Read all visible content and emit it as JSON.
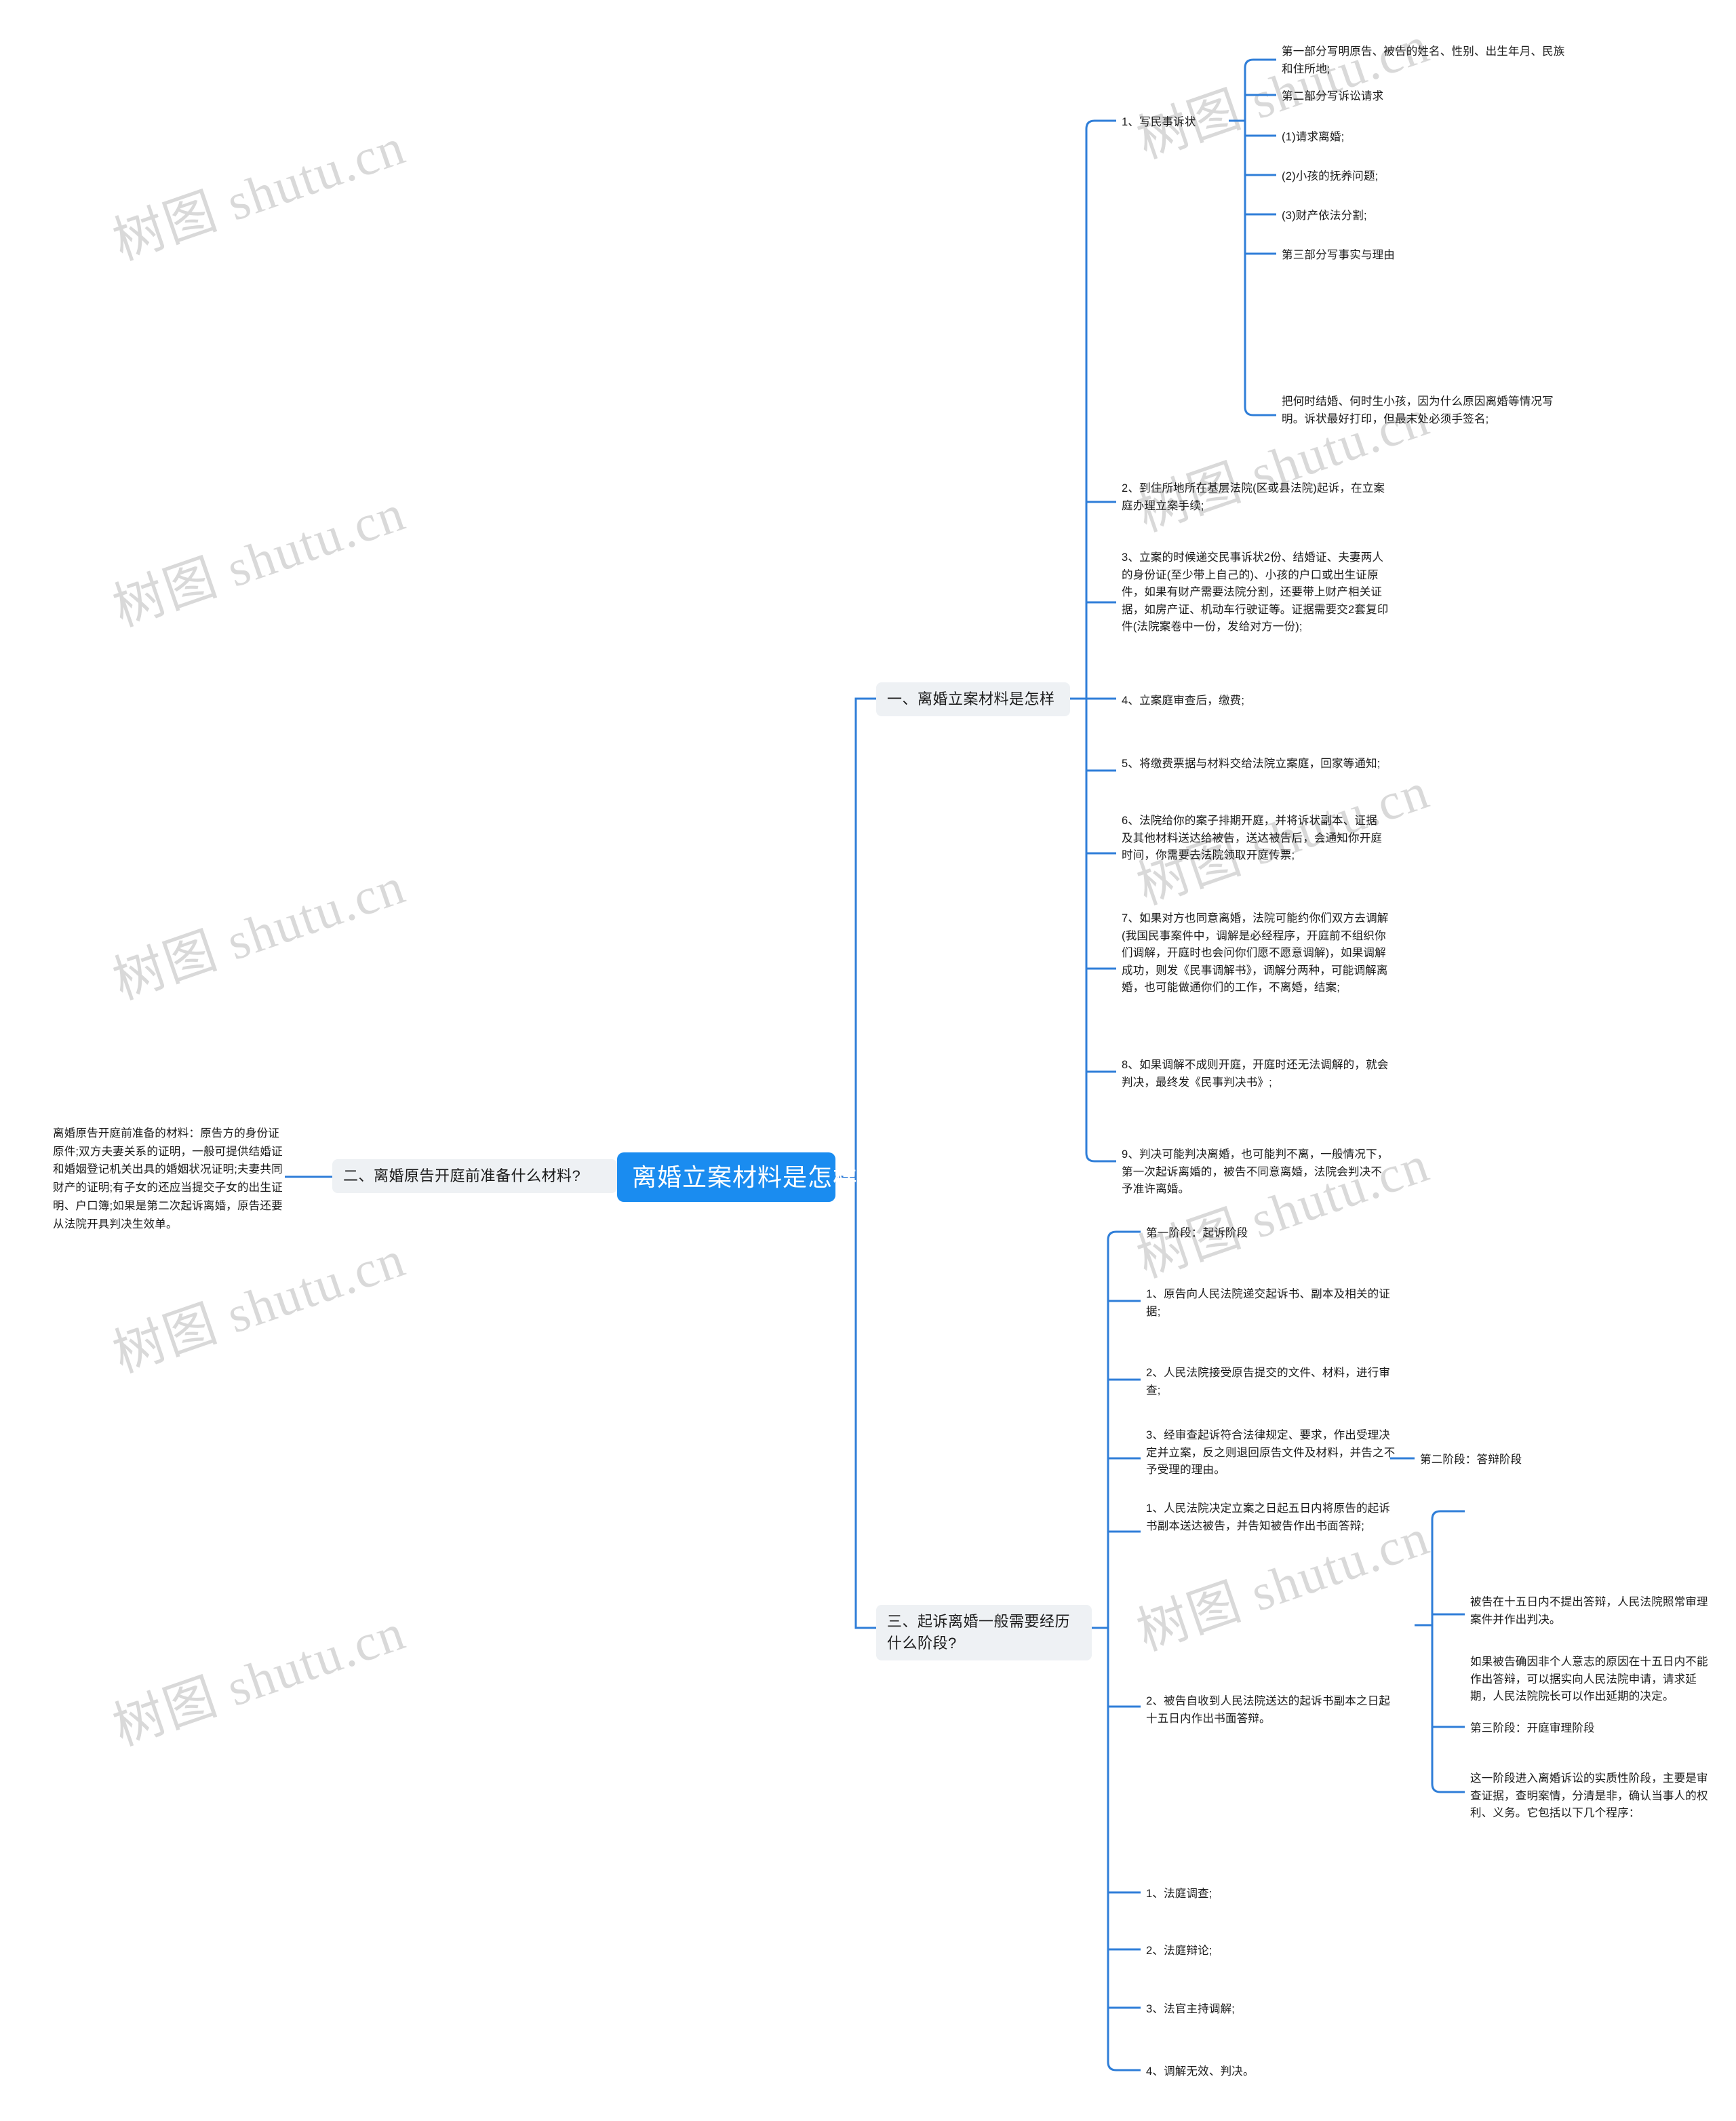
{
  "watermark": {
    "text": "树图 shutu.cn",
    "color": "#d8d8d8"
  },
  "colors": {
    "root_bg": "#1a8cf0",
    "root_text": "#ffffff",
    "branch_bg": "#eef1f4",
    "line": "#2f7ed8",
    "text": "#1b1b1b",
    "page_bg": "#ffffff"
  },
  "root": {
    "label": "离婚立案材料是怎样"
  },
  "left_branch": {
    "label": "二、离婚原告开庭前准备什么材料?",
    "detail": "离婚原告开庭前准备的材料：原告方的身份证原件;双方夫妻关系的证明，一般可提供结婚证和婚姻登记机关出具的婚姻状况证明;夫妻共同财产的证明;有子女的还应当提交子女的出生证明、户口簿;如果是第二次起诉离婚，原告还要从法院开具判决生效单。"
  },
  "branch_one": {
    "label": "一、离婚立案材料是怎样",
    "items": [
      {
        "label": "1、写民事诉状",
        "children": [
          "第一部分写明原告、被告的姓名、性别、出生年月、民族和住所地;",
          "第二部分写诉讼请求",
          "(1)请求离婚;",
          "(2)小孩的抚养问题;",
          "(3)财产依法分割;",
          "第三部分写事实与理由",
          "把何时结婚、何时生小孩，因为什么原因离婚等情况写明。诉状最好打印，但最末处必须手签名;"
        ]
      },
      {
        "label": "2、到住所地所在基层法院(区或县法院)起诉，在立案庭办理立案手续;",
        "children": []
      },
      {
        "label": "3、立案的时候递交民事诉状2份、结婚证、夫妻两人的身份证(至少带上自己的)、小孩的户口或出生证原件，如果有财产需要法院分割，还要带上财产相关证据，如房产证、机动车行驶证等。证据需要交2套复印件(法院案卷中一份，发给对方一份);",
        "children": []
      },
      {
        "label": "4、立案庭审查后，缴费;",
        "children": []
      },
      {
        "label": "5、将缴费票据与材料交给法院立案庭，回家等通知;",
        "children": []
      },
      {
        "label": "6、法院给你的案子排期开庭，并将诉状副本、证据及其他材料送达给被告，送达被告后，会通知你开庭时间，你需要去法院领取开庭传票;",
        "children": []
      },
      {
        "label": "7、如果对方也同意离婚，法院可能约你们双方去调解(我国民事案件中，调解是必经程序，开庭前不组织你们调解，开庭时也会问你们愿不愿意调解)，如果调解成功，则发《民事调解书》，调解分两种，可能调解离婚，也可能做通你们的工作，不离婚，结案;",
        "children": []
      },
      {
        "label": "8、如果调解不成则开庭，开庭时还无法调解的，就会判决，最终发《民事判决书》;",
        "children": []
      },
      {
        "label": "9、判决可能判决离婚，也可能判不离，一般情况下，第一次起诉离婚的，被告不同意离婚，法院会判决不予准许离婚。",
        "children": []
      }
    ]
  },
  "branch_three": {
    "label": "三、起诉离婚一般需要经历什么阶段?",
    "stage_one": {
      "label": "第一阶段：起诉阶段",
      "items": [
        "1、原告向人民法院递交起诉书、副本及相关的证据;",
        "2、人民法院接受原告提交的文件、材料，进行审查;",
        "3、经审查起诉符合法律规定、要求，作出受理决定并立案，反之则退回原告文件及材料，并告之不予受理的理由。"
      ]
    },
    "stage_two": {
      "label": "第二阶段：答辩阶段",
      "items": [
        "1、人民法院决定立案之日起五日内将原告的起诉书副本送达被告，并告知被告作出书面答辩;",
        "2、被告自收到人民法院送达的起诉书副本之日起十五日内作出书面答辩。"
      ],
      "notes": [
        "被告在十五日内不提出答辩，人民法院照常审理案件并作出判决。",
        "如果被告确因非个人意志的原因在十五日内不能作出答辩，可以据实向人民法院申请，请求延期，人民法院院长可以作出延期的决定。"
      ]
    },
    "stage_three": {
      "label": "第三阶段：开庭审理阶段",
      "summary": "这一阶段进入离婚诉讼的实质性阶段，主要是审查证据，查明案情，分清是非，确认当事人的权利、义务。它包括以下几个程序：",
      "items": [
        "1、法庭调查;",
        "2、法庭辩论;",
        "3、法官主持调解;",
        "4、调解无效、判决。"
      ]
    }
  }
}
